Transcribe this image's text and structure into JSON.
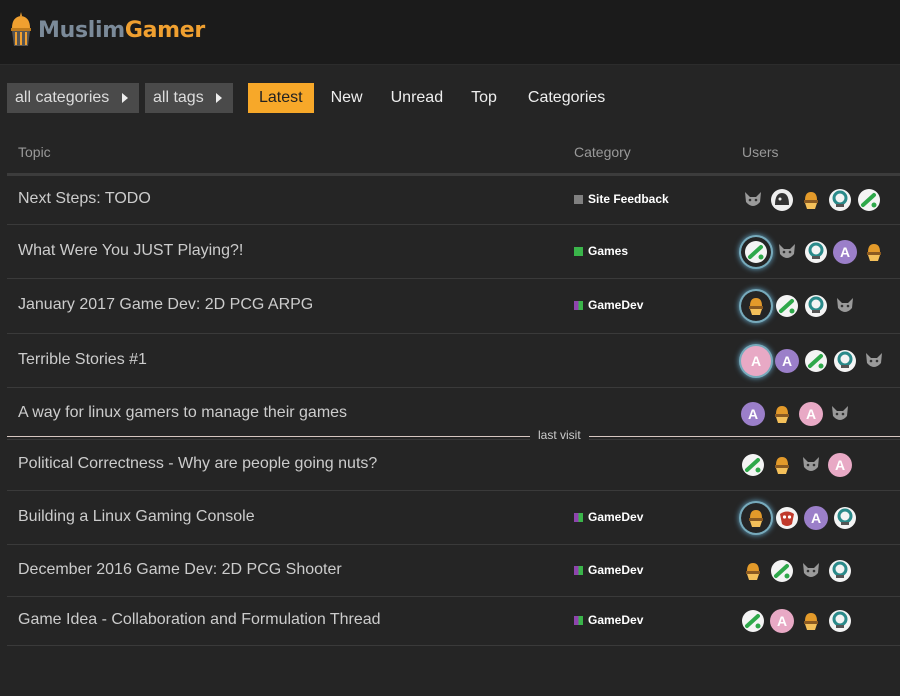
{
  "header": {
    "logo_part1": "Muslim",
    "logo_part2": "Gamer"
  },
  "nav": {
    "category_dropdown": "all categories",
    "tag_dropdown": "all tags",
    "items": [
      "Latest",
      "New",
      "Unread",
      "Top",
      "Categories"
    ],
    "active": "Latest"
  },
  "table": {
    "headers": {
      "topic": "Topic",
      "category": "Category",
      "users": "Users"
    },
    "last_visit_label": "last visit",
    "rows": [
      {
        "title": "Next Steps: TODO",
        "category": "Site Feedback",
        "category_color": "#808080",
        "users": [
          "wolf",
          "dark-beast",
          "lantern",
          "s-logo",
          "green-paw"
        ]
      },
      {
        "title": "What Were You JUST Playing?!",
        "category": "Games",
        "category_color": "#3ab54a",
        "users": [
          "green-paw",
          "wolf",
          "s-logo",
          "letter-a-purple",
          "lantern"
        ]
      },
      {
        "title": "January 2017 Game Dev: 2D PCG ARPG",
        "category": "GameDev",
        "category_color": "#8e44ad",
        "users": [
          "lantern",
          "green-paw",
          "s-logo",
          "wolf"
        ]
      },
      {
        "title": "Terrible Stories #1",
        "category": "",
        "category_color": "",
        "users": [
          "letter-a-pink",
          "letter-a-purple",
          "green-paw",
          "s-logo",
          "wolf"
        ]
      },
      {
        "title": "A way for linux gamers to manage their games",
        "category": "",
        "category_color": "",
        "users": [
          "letter-a-purple",
          "lantern",
          "letter-a-pink",
          "wolf"
        ]
      },
      {
        "title": "Political Correctness - Why are people going nuts?",
        "category": "",
        "category_color": "",
        "users": [
          "green-paw",
          "lantern",
          "wolf",
          "letter-a-pink"
        ]
      },
      {
        "title": "Building a Linux Gaming Console",
        "category": "GameDev",
        "category_color": "#8e44ad",
        "users": [
          "lantern",
          "red-mask",
          "letter-a-purple",
          "s-logo"
        ]
      },
      {
        "title": "December 2016 Game Dev: 2D PCG Shooter",
        "category": "GameDev",
        "category_color": "#8e44ad",
        "users": [
          "lantern",
          "green-paw",
          "wolf",
          "s-logo"
        ]
      },
      {
        "title": "Game Idea - Collaboration and Formulation Thread",
        "category": "GameDev",
        "category_color": "#8e44ad",
        "users": [
          "green-paw",
          "letter-a-pink",
          "lantern",
          "s-logo"
        ]
      }
    ],
    "avatar_letter": "A"
  },
  "colors": {
    "accent": "#f7a829",
    "background": "#252525",
    "header_bg": "#1b1b1b"
  }
}
